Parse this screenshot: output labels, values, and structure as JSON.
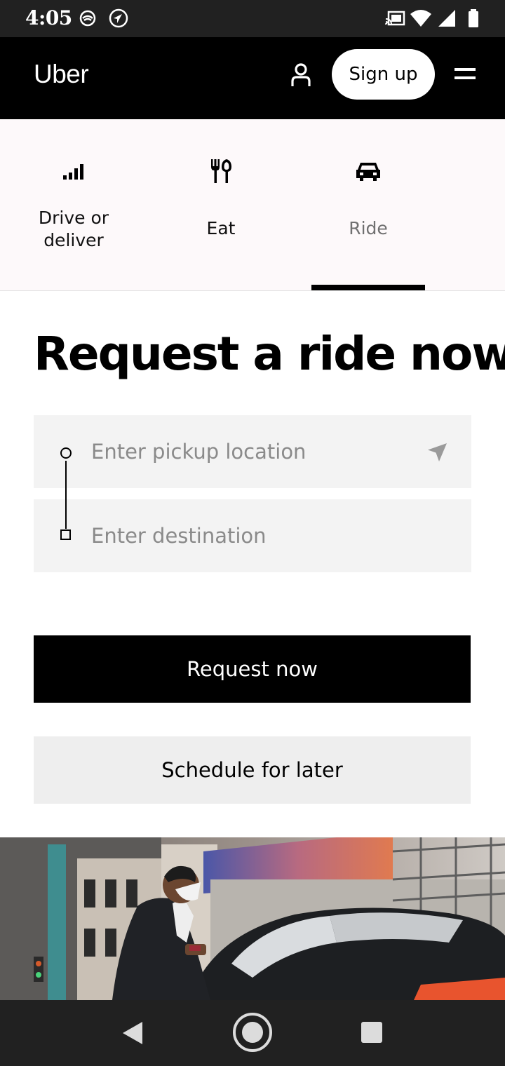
{
  "status_bar": {
    "time": "4:05",
    "left_icons": [
      "ring-app-icon",
      "navigation-app-icon"
    ],
    "right_icons": [
      "cast-icon",
      "wifi-icon",
      "cellular-signal-icon",
      "battery-icon"
    ]
  },
  "header": {
    "logo": "Uber",
    "account_icon": "user-icon",
    "signup_label": "Sign up",
    "menu_icon": "menu-icon"
  },
  "tabs": [
    {
      "label": "Drive or deliver",
      "icon": "signal-bars-icon",
      "active": false
    },
    {
      "label": "Eat",
      "icon": "fork-knife-icon",
      "active": false
    },
    {
      "label": "Ride",
      "icon": "car-icon",
      "active": true
    }
  ],
  "main": {
    "title": "Request a ride now",
    "pickup_placeholder": "Enter pickup location",
    "destination_placeholder": "Enter destination",
    "request_label": "Request now",
    "schedule_label": "Schedule for later"
  },
  "colors": {
    "header_bg": "#000000",
    "primary_button_bg": "#000000",
    "secondary_button_bg": "#eeeeee",
    "input_bg": "#f3f3f3",
    "system_bar_bg": "#212121"
  }
}
